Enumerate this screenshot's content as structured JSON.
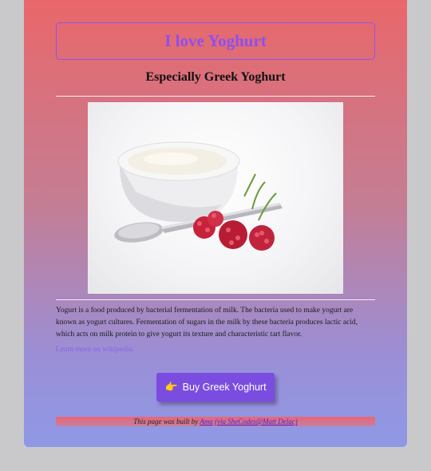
{
  "header": {
    "title": "I love Yoghurt",
    "subtitle": "Especially Greek Yoghurt"
  },
  "content": {
    "description": "Yogurt is a food produced by bacterial fermentation of milk. The bacteria used to make yogurt are known as yogurt cultures. Fermentation of sugars in the milk by these bacteria produces lactic acid, which acts on milk protein to give yogurt its texture and characteristic tart flavor.",
    "link_label": "Learn more on wikipedia."
  },
  "cta": {
    "label": "Buy Greek Yoghurt",
    "icon": "pointing-hand-icon"
  },
  "footer": {
    "prefix": "This page was built by ",
    "author": "Ama",
    "credit": "(via SheCodes@Matt Delac)"
  },
  "colors": {
    "accent": "#8c4ff0",
    "button": "#7a4de0",
    "link": "#8a61e8"
  }
}
